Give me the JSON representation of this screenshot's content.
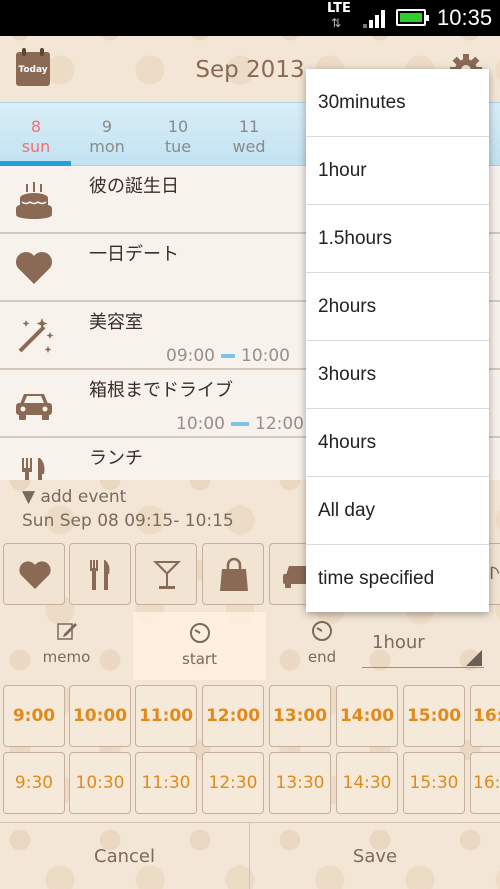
{
  "status_bar": {
    "network": "LTE",
    "time": "10:35"
  },
  "header": {
    "today_label": "Today",
    "month_title": "Sep 2013"
  },
  "week": [
    {
      "num": "8",
      "name": "sun",
      "selected": true
    },
    {
      "num": "9",
      "name": "mon"
    },
    {
      "num": "10",
      "name": "tue"
    },
    {
      "num": "11",
      "name": "wed"
    }
  ],
  "events": [
    {
      "title": "彼の誕生日",
      "icon": "cake-icon",
      "start": "",
      "end": ""
    },
    {
      "title": "一日デート",
      "icon": "heart-icon",
      "start": "",
      "end": ""
    },
    {
      "title": "美容室",
      "icon": "magic-wand-icon",
      "start": "09:00",
      "end": "10:00"
    },
    {
      "title": "箱根までドライブ",
      "icon": "car-icon",
      "start": "10:00",
      "end": "12:00"
    },
    {
      "title": "ランチ",
      "icon": "fork-knife-icon",
      "start": "",
      "end": ""
    }
  ],
  "add_event": {
    "label": "▼ add event",
    "datetime": "Sun Sep 08 09:15- 10:15"
  },
  "categories": [
    "heart-icon",
    "fork-knife-icon",
    "cocktail-icon",
    "shopping-bag-icon",
    "car-icon",
    "music-icon"
  ],
  "modes": {
    "memo": "memo",
    "start": "start",
    "end": "end",
    "duration": "1hour"
  },
  "times_row1": [
    "9:00",
    "10:00",
    "11:00",
    "12:00",
    "13:00",
    "14:00",
    "15:00",
    "16:"
  ],
  "times_row2": [
    "9:30",
    "10:30",
    "11:30",
    "12:30",
    "13:30",
    "14:30",
    "15:30",
    "16:"
  ],
  "buttons": {
    "cancel": "Cancel",
    "save": "Save"
  },
  "dropdown": [
    "30minutes",
    "1hour",
    "1.5hours",
    "2hours",
    "3hours",
    "4hours",
    "All day",
    "time specified"
  ],
  "colors": {
    "accent": "#e08a1c",
    "selected_day": "#f07070",
    "week_underline": "#26a0d8",
    "icon_brown": "#8a6a55"
  }
}
